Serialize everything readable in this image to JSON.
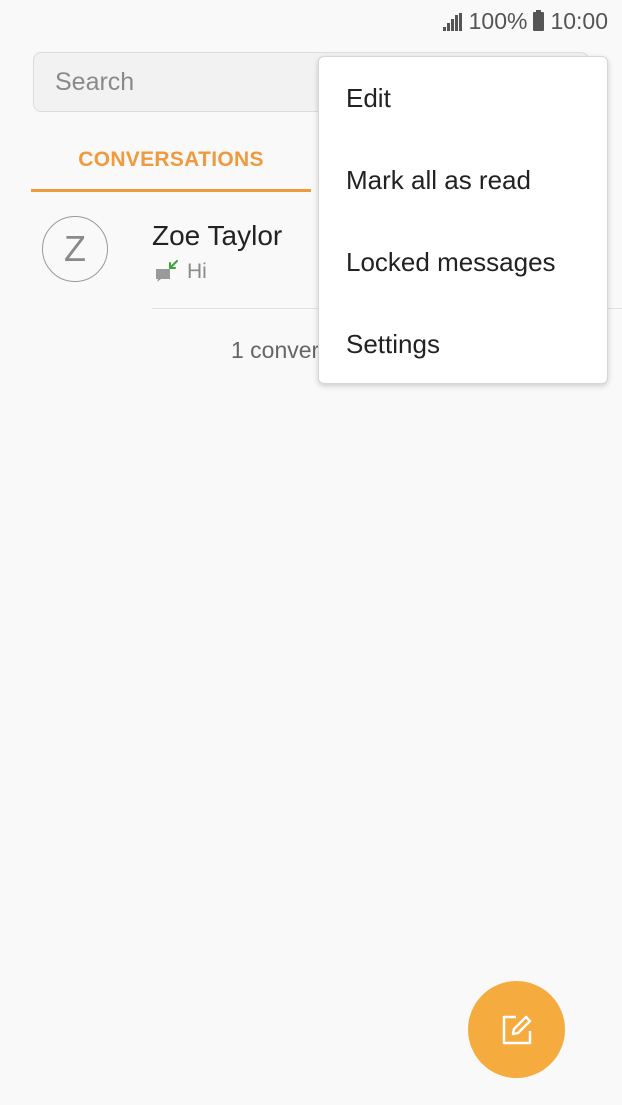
{
  "status_bar": {
    "battery_percent": "100%",
    "time": "10:00"
  },
  "search": {
    "placeholder": "Search",
    "value": ""
  },
  "tabs": [
    {
      "label": "CONVERSATIONS",
      "active": true
    }
  ],
  "conversations": [
    {
      "avatar_initial": "Z",
      "name": "Zoe Taylor",
      "preview": "Hi",
      "direction_icon": "incoming-message-icon"
    }
  ],
  "conversation_count": "1 conver",
  "menu": {
    "items": [
      "Edit",
      "Mark all as read",
      "Locked messages",
      "Settings"
    ]
  },
  "fab": {
    "icon": "compose-icon"
  },
  "colors": {
    "accent": "#f09a3e",
    "fab": "#f5ab3d",
    "incoming_arrow": "#3aa43c"
  }
}
